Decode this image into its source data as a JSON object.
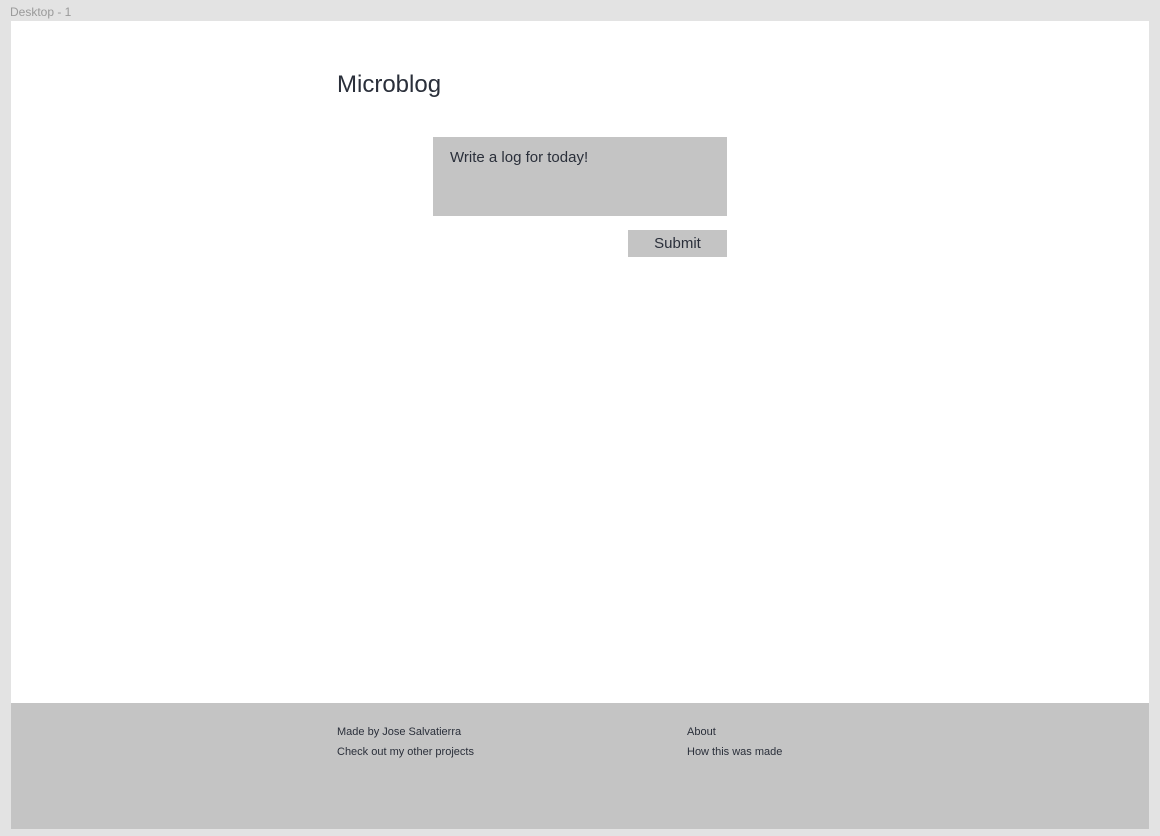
{
  "frame_label": "Desktop - 1",
  "header": {
    "title": "Microblog"
  },
  "form": {
    "placeholder": "Write a log for today!",
    "value": "",
    "submit_label": "Submit"
  },
  "footer": {
    "left": [
      "Made by Jose Salvatierra",
      "Check out my other projects"
    ],
    "right": [
      "About",
      "How this was made"
    ]
  }
}
